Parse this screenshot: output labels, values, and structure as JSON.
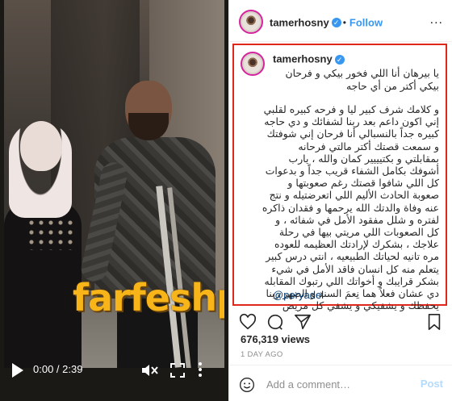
{
  "video": {
    "current_time": "0:00",
    "duration": "2:39",
    "time_separator": " / ",
    "watermark_text": "farfeshplus.com"
  },
  "post": {
    "username": "tamerhosny",
    "verified": true,
    "follow_label": "Follow",
    "more_label": "...",
    "caption_line1": "يا بيرهان أنا اللي فخور بيكي و فرحان بيكي أكتر من أي حاجه",
    "caption_body": "و كلامك شرف كبير ليا و فرحه كبيره لقلبي إني اكون داعم بعد ربنا لشفائك و دي حاجه كبيره جداً بالنسبالي أنا فرحان إني شوفتك و سمعت قصتك أكتر مالتي فرحانه بمقابلتي و بكتيييير كمان والله ، يارب أشوفك بكامل الشفاء قريب جداً و بدعوات كل اللي شافوا قصتك رغم صعوبتها و صعوبة الحادث الأليم اللي اتعرضتيله و نتج عنه وفاة والدتك الله يرحمها و فقدان ذاكره لفتره و شلل مفقود الأمل في شفائه ، و كل الصعوبات اللي مريتي بيها في رحلة علاجك ، بشكرك لإرادتك العظيمه للعوده مره تانيه لحياتك الطبيعيه ، انتي درس كبير يتعلم منه كل انسان فاقد الأمل في شيء بشكر قرايبك و أخواتك اللي رتبوك المقابله دي عشان فعلاً هما نِعمَ السند و الضهر ربنا يحفظك و يشفيكي و يشفي كل مريض",
    "mention": "@peryadel",
    "views_count": "676,319",
    "views_label": "views",
    "time_ago": "1 DAY AGO"
  },
  "comment": {
    "placeholder": "Add a comment…",
    "post_label": "Post"
  },
  "colors": {
    "accent_blue": "#3897f0",
    "highlight_border": "#e0271c",
    "watermark": "#f7b51a",
    "muted_text": "#8e8e8e",
    "post_disabled": "#b3dbff"
  }
}
